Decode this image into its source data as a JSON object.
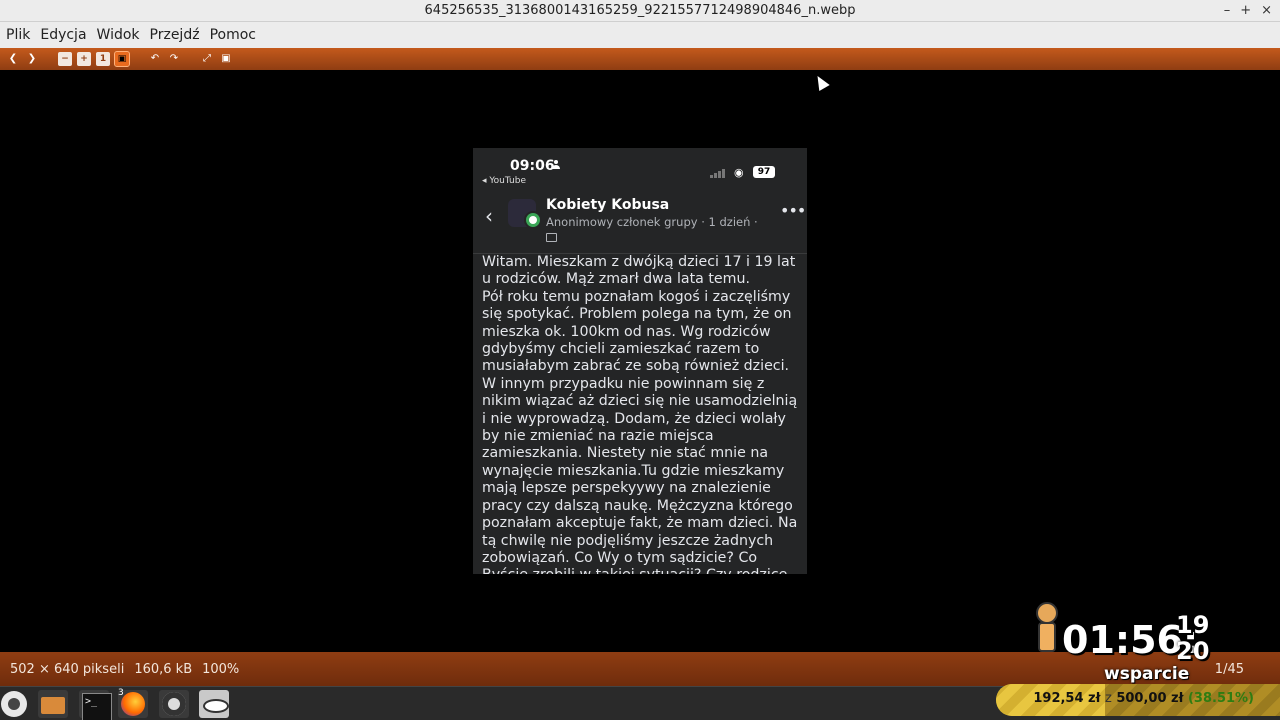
{
  "window": {
    "title": "645256535_3136800143165259_9221557712498904846_n.webp",
    "controls": [
      "–",
      "+",
      "×"
    ]
  },
  "menu": [
    "Plik",
    "Edycja",
    "Widok",
    "Przejdź",
    "Pomoc"
  ],
  "toolbar": {
    "buttons": [
      "previous-icon",
      "next-icon",
      "zoom-out-icon",
      "zoom-in-icon",
      "zoom-normal-icon",
      "best-fit-icon",
      "rotate-left-icon",
      "rotate-right-icon",
      "fullscreen-icon",
      "slideshow-icon"
    ],
    "zoom_normal_label": "1"
  },
  "phone": {
    "time": "09:06",
    "back_app": "◂ YouTube",
    "battery": "97",
    "group_name": "Kobiety Kobusa",
    "meta": "Anonimowy członek grupy · 1 dzień ·",
    "post_text": "Witam. Mieszkam z dwójką dzieci 17 i 19 lat u rodziców. Mąż zmarł dwa lata temu.\nPół roku temu poznałam kogoś i zaczęliśmy się spotykać. Problem polega na tym, że on mieszka ok. 100km od nas. Wg rodziców gdybyśmy chcieli zamieszkać razem to musiałabym zabrać ze sobą również dzieci. W innym przypadku nie powinnam się z nikim wiązać aż dzieci się nie usamodzielnią i nie wyprowadzą. Dodam, że dzieci wolały by nie zmieniać na razie miejsca zamieszkania. Niestety nie stać mnie na wynajęcie mieszkania.Tu gdzie mieszkamy mają lepsze perspekyywy na znalezienie  pracy czy dalszą naukę. Mężczyzna którego poznałam akceptuje fakt, że mam dzieci. Na tą chwilę nie podjęliśmy jeszcze żadnych zobowiązań. Co Wy o tym sądzicie? Co Byście zrobili w takiej sytuacji? Czy rodzice mają rację?"
  },
  "statusbar": {
    "dimensions": "502 × 640 pikseli",
    "size": "160,6 kB",
    "zoom": "100%",
    "page": "1/45"
  },
  "taskbar": {
    "apps": [
      "mint-menu-icon",
      "folder-icon",
      "terminal-icon",
      "firefox-icon",
      "obs-icon",
      "image-viewer-icon"
    ],
    "firefox_badge": "3"
  },
  "overlay": {
    "timer": "01:56:",
    "timer_seconds_top": "19",
    "timer_seconds_bottom": "20",
    "label": "wsparcie",
    "donation_current": "192,54 zł",
    "donation_sep": "z",
    "donation_goal": "500,00 zł",
    "donation_percent": "(38.51%)",
    "donation_progress": 0.3851
  }
}
